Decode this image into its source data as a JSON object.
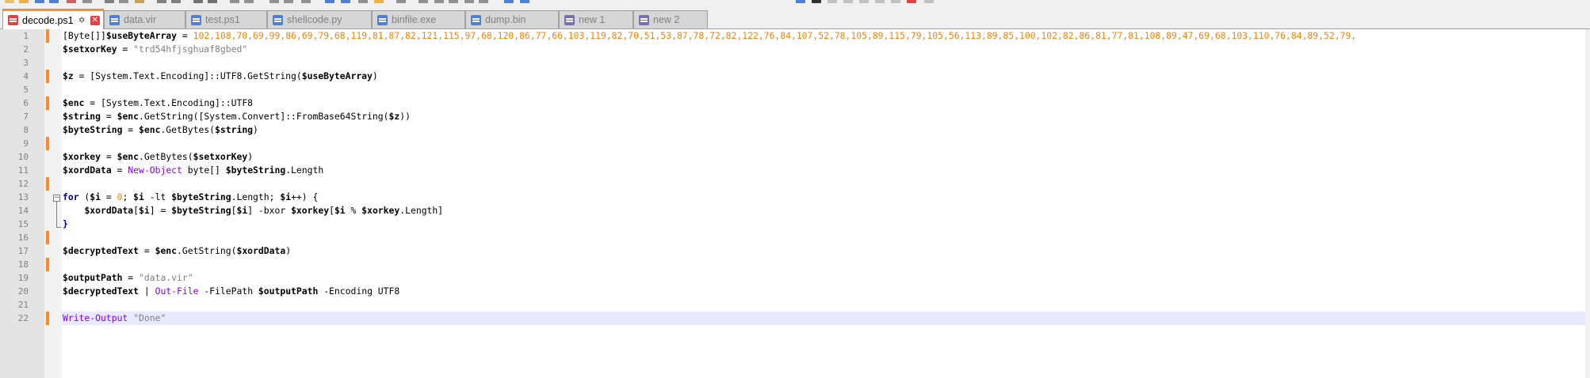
{
  "tabs": [
    {
      "label": "decode.ps1",
      "active": true,
      "icon": "ps1-file-icon",
      "icon_color": "#e04343"
    },
    {
      "label": "data.vir",
      "active": false,
      "icon": "file-icon",
      "icon_color": "#4f7fd0"
    },
    {
      "label": "test.ps1",
      "active": false,
      "icon": "file-icon",
      "icon_color": "#4f7fd0"
    },
    {
      "label": "shellcode.py",
      "active": false,
      "icon": "file-icon",
      "icon_color": "#4f7fd0"
    },
    {
      "label": "binfile.exe",
      "active": false,
      "icon": "file-icon",
      "icon_color": "#4f7fd0"
    },
    {
      "label": "dump.bin",
      "active": false,
      "icon": "file-icon",
      "icon_color": "#4f7fd0"
    },
    {
      "label": "new 1",
      "active": false,
      "icon": "file-icon",
      "icon_color": "#7a6fb0"
    },
    {
      "label": "new 2",
      "active": false,
      "icon": "file-icon",
      "icon_color": "#7a6fb0"
    }
  ],
  "active_tab_pin": "✡",
  "active_tab_close": "✕",
  "colors": {
    "accent": "#fa8c2b",
    "keyword": "#00008b",
    "number": "#ff8000",
    "string": "#808080",
    "cmdlet": "#8000ff",
    "current_line": "#e8e8ff"
  },
  "current_line": 22,
  "line_numbers": [
    "1",
    "2",
    "3",
    "4",
    "5",
    "6",
    "7",
    "8",
    "9",
    "10",
    "11",
    "12",
    "13",
    "14",
    "15",
    "16",
    "17",
    "18",
    "19",
    "20",
    "21",
    "22"
  ],
  "code": {
    "l1": {
      "type": "[Byte[]]",
      "var": "$useByteArray",
      "eq": " = ",
      "nums": "102,108,70,69,99,86,69,79,68,119,81,87,82,121,115,97,68,120,86,77,66,103,119,82,70,51,53,87,78,72,82,122,76,84,107,52,78,105,89,115,79,105,56,113,89,85,100,102,82,86,81,77,81,108,89,47,69,68,103,110,76,84,89,52,79,"
    },
    "l2": {
      "var": "$setxorKey",
      "eq": " = ",
      "str": "\"trd54hfjsghuaf8gbed\""
    },
    "l4": {
      "var": "$z",
      "eq": " = ",
      "rest": "[System.Text.Encoding]::UTF8.GetString(",
      "arg": "$useByteArray",
      "close": ")"
    },
    "l6": {
      "var": "$enc",
      "eq": " = ",
      "rest": "[System.Text.Encoding]::UTF8"
    },
    "l7": {
      "var": "$string",
      "eq": " = ",
      "v2": "$enc",
      "rest": ".GetString([System.Convert]::FromBase64String(",
      "arg": "$z",
      "close": "))"
    },
    "l8": {
      "var": "$byteString",
      "eq": " = ",
      "v2": "$enc",
      "rest": ".GetBytes(",
      "arg": "$string",
      "close": ")"
    },
    "l10": {
      "var": "$xorkey",
      "eq": " = ",
      "v2": "$enc",
      "rest": ".GetBytes(",
      "arg": "$setxorKey",
      "close": ")"
    },
    "l11": {
      "var": "$xordData",
      "eq": " = ",
      "cmd": "New-Object",
      "rest": " byte[] ",
      "arg": "$byteString",
      "close": ".Length"
    },
    "l13": {
      "kw": "for",
      "p1": " (",
      "v1": "$i",
      "p2": " = ",
      "zero": "0",
      "p3": "; ",
      "v2": "$i",
      "p4": " -lt ",
      "v3": "$byteString",
      "p5": ".Length; ",
      "v4": "$i",
      "p6": "++) {"
    },
    "l14": {
      "indent": "    ",
      "v1": "$xordData",
      "p1": "[",
      "v2": "$i",
      "p2": "] = ",
      "v3": "$byteString",
      "p3": "[",
      "v4": "$i",
      "p4": "] -bxor ",
      "v5": "$xorkey",
      "p5": "[",
      "v6": "$i",
      "p6": " % ",
      "v7": "$xorkey",
      "p7": ".Length]"
    },
    "l15": {
      "text": "}"
    },
    "l17": {
      "var": "$decryptedText",
      "eq": " = ",
      "v2": "$enc",
      "rest": ".GetString(",
      "arg": "$xordData",
      "close": ")"
    },
    "l19": {
      "var": "$outputPath",
      "eq": " = ",
      "str": "\"data.vir\""
    },
    "l20": {
      "var": "$decryptedText",
      "p1": " | ",
      "cmd": "Out-File",
      "p2": " -FilePath ",
      "arg": "$outputPath",
      "p3": " -Encoding UTF8"
    },
    "l22": {
      "cmd": "Write-Output",
      "p1": " ",
      "str": "\"Done\""
    }
  }
}
